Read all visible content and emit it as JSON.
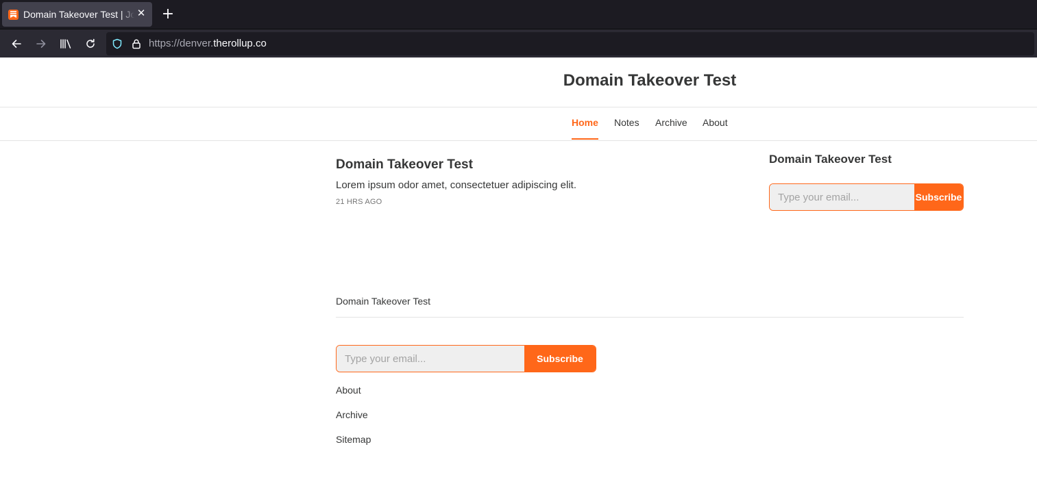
{
  "browser": {
    "tab_title": "Domain Takeover Test | Jo",
    "new_tab_label": "+",
    "url_prefix": "https://denver.",
    "url_domain": "therollup.co"
  },
  "site": {
    "title": "Domain Takeover Test",
    "nav": [
      {
        "label": "Home",
        "active": true
      },
      {
        "label": "Notes",
        "active": false
      },
      {
        "label": "Archive",
        "active": false
      },
      {
        "label": "About",
        "active": false
      }
    ]
  },
  "post": {
    "title": "Domain Takeover Test",
    "excerpt": "Lorem ipsum odor amet, consectetuer adipiscing elit.",
    "date": "21 HRS AGO"
  },
  "sidebar": {
    "title": "Domain Takeover Test",
    "subscribe": {
      "placeholder": "Type your email...",
      "button": "Subscribe"
    }
  },
  "footer": {
    "name": "Domain Takeover Test",
    "subscribe": {
      "placeholder": "Type your email...",
      "button": "Subscribe"
    },
    "links": [
      "About",
      "Archive",
      "Sitemap"
    ]
  },
  "colors": {
    "accent": "#ff6719",
    "text": "#363737"
  }
}
